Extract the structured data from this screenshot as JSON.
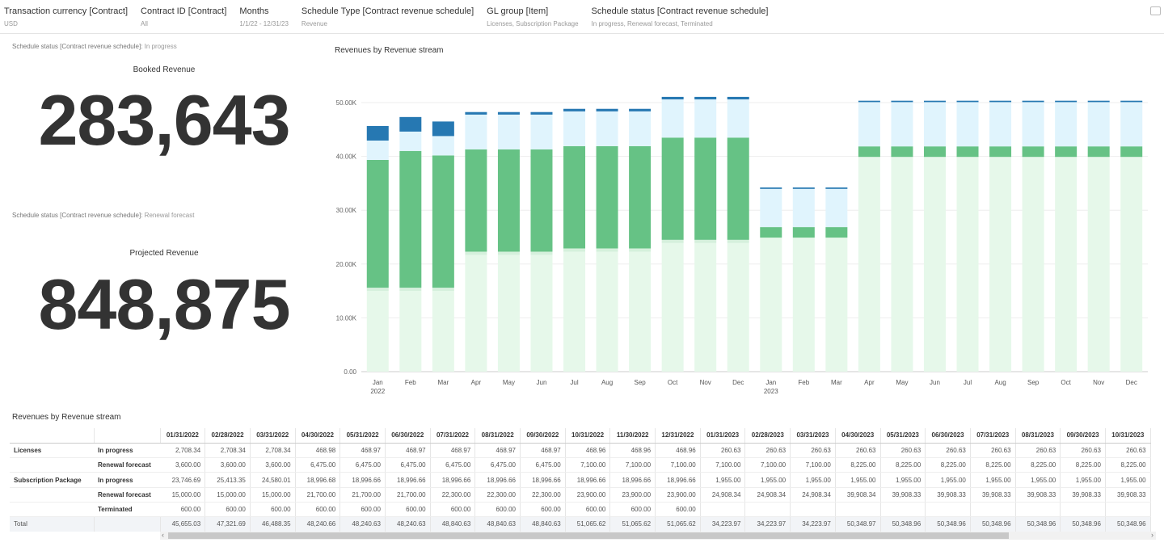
{
  "filters": [
    {
      "label": "Transaction currency [Contract]",
      "value": "USD"
    },
    {
      "label": "Contract ID [Contract]",
      "value": "All"
    },
    {
      "label": "Months",
      "value": "1/1/22 - 12/31/23"
    },
    {
      "label": "Schedule Type [Contract revenue schedule]",
      "value": "Revenue"
    },
    {
      "label": "GL group [Item]",
      "value": "Licenses, Subscription Package"
    },
    {
      "label": "Schedule status [Contract revenue schedule]",
      "value": "In progress, Renewal forecast, Terminated"
    }
  ],
  "kpis": [
    {
      "caption_label": "Schedule status [Contract revenue schedule]:",
      "caption_value": "In progress",
      "title": "Booked Revenue",
      "value": "283,643"
    },
    {
      "caption_label": "Schedule status [Contract revenue schedule]:",
      "caption_value": "Renewal forecast",
      "title": "Projected Revenue",
      "value": "848,875"
    }
  ],
  "colors": {
    "licenses_in_progress": "#2678b2",
    "licenses_renewal": "#e0f4fd",
    "subscription_in_progress": "#66c285",
    "subscription_renewal": "#e6f8ea",
    "terminated": "#d5f0dc"
  },
  "chart_data": {
    "type": "bar",
    "stacked": true,
    "title": "Revenues by Revenue stream",
    "categories": [
      "Jan",
      "Feb",
      "Mar",
      "Apr",
      "May",
      "Jun",
      "Jul",
      "Aug",
      "Sep",
      "Oct",
      "Nov",
      "Dec",
      "Jan",
      "Feb",
      "Mar",
      "Apr",
      "May",
      "Jun",
      "Jul",
      "Aug",
      "Sep",
      "Oct",
      "Nov",
      "Dec"
    ],
    "year_labels": {
      "0": "2022",
      "12": "2023"
    },
    "yticks": [
      "0.00",
      "10.00K",
      "20.00K",
      "30.00K",
      "40.00K",
      "50.00K"
    ],
    "ylim": [
      0,
      50000
    ],
    "grid": true,
    "series": [
      {
        "key": "subscription_renewal",
        "values": [
          15000,
          15000,
          15000,
          21700,
          21700,
          21700,
          22300,
          22300,
          22300,
          23900,
          23900,
          23900,
          24908.34,
          24908.34,
          24908.34,
          39908.34,
          39908.33,
          39908.33,
          39908.33,
          39908.33,
          39908.33,
          39908.33,
          39908.33,
          39908.33
        ]
      },
      {
        "key": "terminated",
        "values": [
          600,
          600,
          600,
          600,
          600,
          600,
          600,
          600,
          600,
          600,
          600,
          600,
          0,
          0,
          0,
          0,
          0,
          0,
          0,
          0,
          0,
          0,
          0,
          0
        ]
      },
      {
        "key": "subscription_in_progress",
        "values": [
          23746.69,
          25413.35,
          24580.01,
          18996.68,
          18996.66,
          18996.66,
          18996.66,
          18996.66,
          18996.66,
          18996.66,
          18996.66,
          18996.66,
          1955,
          1955,
          1955,
          1955,
          1955,
          1955,
          1955,
          1955,
          1955,
          1955,
          1955,
          1955
        ]
      },
      {
        "key": "licenses_renewal",
        "values": [
          3600,
          3600,
          3600,
          6475,
          6475,
          6475,
          6475,
          6475,
          6475,
          7100,
          7100,
          7100,
          7100,
          7100,
          7100,
          8225,
          8225,
          8225,
          8225,
          8225,
          8225,
          8225,
          8225,
          8225
        ]
      },
      {
        "key": "licenses_in_progress",
        "values": [
          2708.34,
          2708.34,
          2708.34,
          468.98,
          468.97,
          468.97,
          468.97,
          468.97,
          468.97,
          468.96,
          468.96,
          468.96,
          260.63,
          260.63,
          260.63,
          260.63,
          260.63,
          260.63,
          260.63,
          260.63,
          260.63,
          260.63,
          260.63,
          260.63
        ]
      }
    ]
  },
  "table": {
    "title": "Revenues by Revenue stream",
    "dates": [
      "01/31/2022",
      "02/28/2022",
      "03/31/2022",
      "04/30/2022",
      "05/31/2022",
      "06/30/2022",
      "07/31/2022",
      "08/31/2022",
      "09/30/2022",
      "10/31/2022",
      "11/30/2022",
      "12/31/2022",
      "01/31/2023",
      "02/28/2023",
      "03/31/2023",
      "04/30/2023",
      "05/31/2023",
      "06/30/2023",
      "07/31/2023",
      "08/31/2023",
      "09/30/2023",
      "10/31/2023"
    ],
    "rows": [
      {
        "group": "Licenses",
        "status": "In progress",
        "values": [
          "2,708.34",
          "2,708.34",
          "2,708.34",
          "468.98",
          "468.97",
          "468.97",
          "468.97",
          "468.97",
          "468.97",
          "468.96",
          "468.96",
          "468.96",
          "260.63",
          "260.63",
          "260.63",
          "260.63",
          "260.63",
          "260.63",
          "260.63",
          "260.63",
          "260.63",
          "260.63"
        ]
      },
      {
        "group": "",
        "status": "Renewal forecast",
        "values": [
          "3,600.00",
          "3,600.00",
          "3,600.00",
          "6,475.00",
          "6,475.00",
          "6,475.00",
          "6,475.00",
          "6,475.00",
          "6,475.00",
          "7,100.00",
          "7,100.00",
          "7,100.00",
          "7,100.00",
          "7,100.00",
          "7,100.00",
          "8,225.00",
          "8,225.00",
          "8,225.00",
          "8,225.00",
          "8,225.00",
          "8,225.00",
          "8,225.00"
        ]
      },
      {
        "group": "Subscription Package",
        "status": "In progress",
        "values": [
          "23,746.69",
          "25,413.35",
          "24,580.01",
          "18,996.68",
          "18,996.66",
          "18,996.66",
          "18,996.66",
          "18,996.66",
          "18,996.66",
          "18,996.66",
          "18,996.66",
          "18,996.66",
          "1,955.00",
          "1,955.00",
          "1,955.00",
          "1,955.00",
          "1,955.00",
          "1,955.00",
          "1,955.00",
          "1,955.00",
          "1,955.00",
          "1,955.00"
        ]
      },
      {
        "group": "",
        "status": "Renewal forecast",
        "values": [
          "15,000.00",
          "15,000.00",
          "15,000.00",
          "21,700.00",
          "21,700.00",
          "21,700.00",
          "22,300.00",
          "22,300.00",
          "22,300.00",
          "23,900.00",
          "23,900.00",
          "23,900.00",
          "24,908.34",
          "24,908.34",
          "24,908.34",
          "39,908.34",
          "39,908.33",
          "39,908.33",
          "39,908.33",
          "39,908.33",
          "39,908.33",
          "39,908.33"
        ]
      },
      {
        "group": "",
        "status": "Terminated",
        "values": [
          "600.00",
          "600.00",
          "600.00",
          "600.00",
          "600.00",
          "600.00",
          "600.00",
          "600.00",
          "600.00",
          "600.00",
          "600.00",
          "600.00",
          "",
          "",
          "",
          "",
          "",
          "",
          "",
          "",
          "",
          ""
        ]
      }
    ],
    "total_label": "Total",
    "totals": [
      "45,655.03",
      "47,321.69",
      "46,488.35",
      "48,240.66",
      "48,240.63",
      "48,240.63",
      "48,840.63",
      "48,840.63",
      "48,840.63",
      "51,065.62",
      "51,065.62",
      "51,065.62",
      "34,223.97",
      "34,223.97",
      "34,223.97",
      "50,348.97",
      "50,348.96",
      "50,348.96",
      "50,348.96",
      "50,348.96",
      "50,348.96",
      "50,348.96"
    ]
  }
}
